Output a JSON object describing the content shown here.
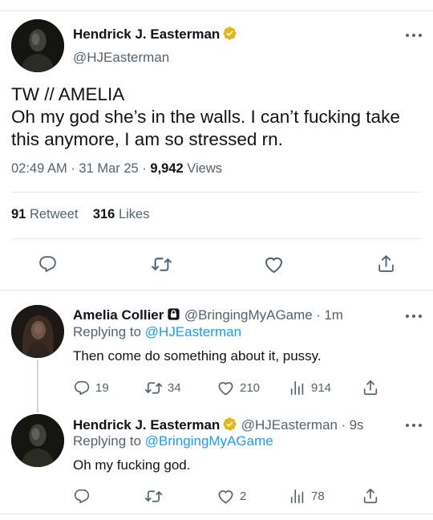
{
  "main_tweet": {
    "author_name": "Hendrick J. Easterman",
    "author_handle": "@HJEasterman",
    "text_line1": "TW // AMELIA",
    "text_line2": "Oh my god she’s in the walls. I can’t fucking take this anymore, I am so stressed rn.",
    "time": "02:49 AM",
    "date": "31 Mar 25",
    "separator": "·",
    "views_count": "9,942",
    "views_label": "Views",
    "retweets_count": "91",
    "retweets_label": "Retweet",
    "likes_count": "316",
    "likes_label": "Likes"
  },
  "replies": [
    {
      "author_name": "Amelia Collier",
      "author_handle": "@BringingMyAGame",
      "time": "1m",
      "replying_prefix": "Replying to",
      "replying_handle": "@HJEasterman",
      "text": "Then come do something about it, pussy.",
      "reply_count": "19",
      "retweet_count": "34",
      "like_count": "210",
      "view_count": "914"
    },
    {
      "author_name": "Hendrick J. Easterman",
      "author_handle": "@HJEasterman",
      "time": "9s",
      "replying_prefix": "Replying to",
      "replying_handle": "@BringingMyAGame",
      "text": "Oh my fucking god.",
      "reply_count": "",
      "retweet_count": "",
      "like_count": "2",
      "view_count": "78"
    }
  ],
  "icons": {
    "verified": "verified-badge-icon",
    "lock": "lock-icon",
    "more": "more-icon",
    "reply": "reply-icon",
    "retweet": "retweet-icon",
    "like": "heart-icon",
    "share": "share-icon",
    "views": "views-icon"
  },
  "colors": {
    "verified_gold": "#e2b719",
    "link_blue": "#1d9bf0",
    "secondary_gray": "#536471",
    "text_dark": "#0f1419"
  }
}
